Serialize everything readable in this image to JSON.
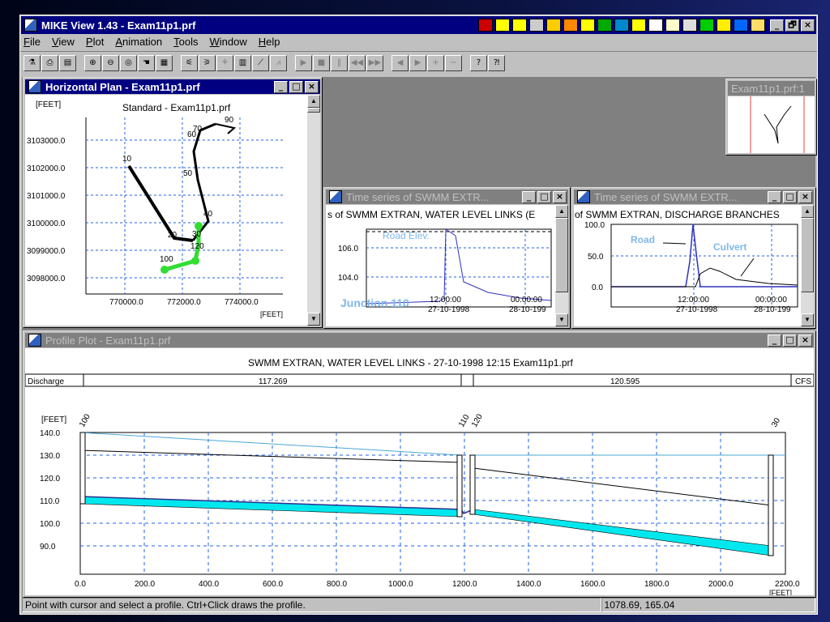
{
  "app": {
    "title": "MIKE View 1.43 - Exam11p1.prf",
    "window_controls": [
      "_",
      "🗗",
      "×"
    ]
  },
  "menu": [
    "File",
    "View",
    "Plot",
    "Animation",
    "Tools",
    "Window",
    "Help"
  ],
  "horizontal_plan": {
    "window_title": "Horizontal Plan - Exam11p1.prf",
    "unit_top": "[FEET]",
    "unit_bottom": "[FEET]",
    "plot_title": "Standard - Exam11p1.prf",
    "y_ticks": [
      "3103000.0",
      "3102000.0",
      "3101000.0",
      "3100000.0",
      "3099000.0",
      "3098000.0"
    ],
    "x_ticks": [
      "770000.0",
      "772000.0",
      "774000.0"
    ],
    "node_labels": [
      "10",
      "20",
      "30",
      "40",
      "50",
      "60",
      "70",
      "90",
      "100",
      "120"
    ]
  },
  "overview": {
    "window_title": "Exam11p1.prf:1"
  },
  "timeseries_level": {
    "window_title": "Time series of SWMM EXTR...",
    "header": "s of SWMM EXTRAN, WATER LEVEL LINKS (E",
    "annotation_road": "Road Elev.",
    "annotation_junction": "Junction 110",
    "y_ticks": [
      "106.0",
      "104.0"
    ],
    "x_ticks": [
      {
        "time": "12:00:00",
        "date": "27-10-1998"
      },
      {
        "time": "00:00:00",
        "date": "28-10-199"
      }
    ]
  },
  "timeseries_discharge": {
    "window_title": "Time series of SWMM EXTR...",
    "header": "of SWMM EXTRAN, DISCHARGE BRANCHES",
    "annotation_road": "Road",
    "annotation_culvert": "Culvert",
    "y_ticks": [
      "100.0",
      "50.0",
      "0.0"
    ],
    "x_ticks": [
      {
        "time": "12:00:00",
        "date": "27-10-1998"
      },
      {
        "time": "00:00:00",
        "date": "28-10-199"
      }
    ]
  },
  "profile": {
    "window_title": "Profile Plot - Exam11p1.prf",
    "plot_title": "SWMM EXTRAN, WATER LEVEL LINKS - 27-10-1998 12:15 Exam11p1.prf",
    "discharge_label": "Discharge",
    "discharge_1": "117.269",
    "discharge_2": "120.595",
    "discharge_unit": "CFS",
    "unit_y": "[FEET]",
    "unit_x": "[FEET]",
    "y_ticks": [
      "140.0",
      "130.0",
      "120.0",
      "110.0",
      "100.0",
      "90.0"
    ],
    "x_ticks": [
      "0.0",
      "200.0",
      "400.0",
      "600.0",
      "800.0",
      "1000.0",
      "1200.0",
      "1400.0",
      "1600.0",
      "1800.0",
      "2000.0",
      "2200.0"
    ],
    "node_labels": [
      "100",
      "110",
      "120",
      "30"
    ],
    "colors": {
      "water": "#00e8ee",
      "ground": "#000000",
      "road": "#4aa8d8"
    }
  },
  "status": {
    "message": "Point with cursor and select a profile. Ctrl+Click draws the profile.",
    "coords": "1078.69, 165.04"
  }
}
